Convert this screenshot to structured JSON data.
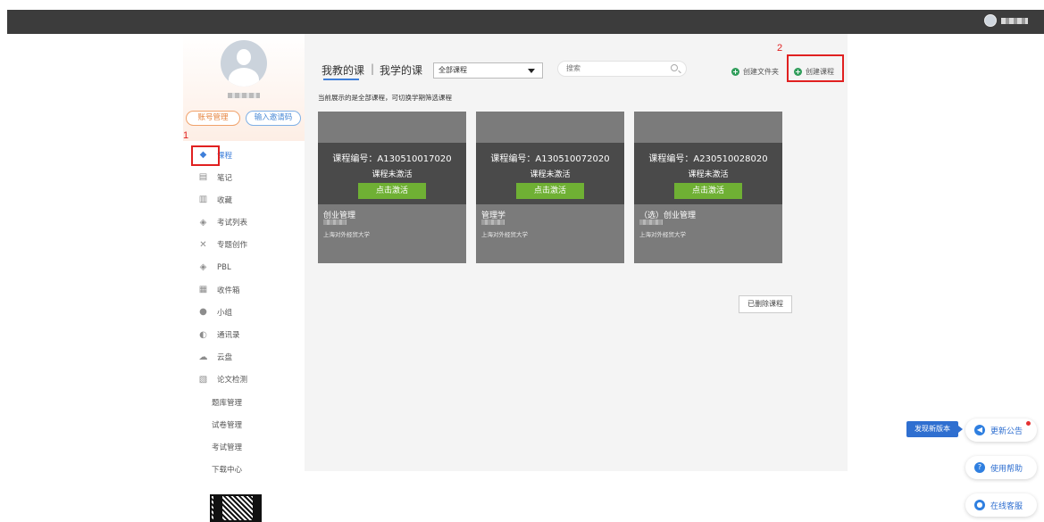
{
  "sidebar": {
    "account_btn": "账号管理",
    "invite_btn": "输入邀请码",
    "items": [
      {
        "label": "课程",
        "icon": "course-icon",
        "active": true
      },
      {
        "label": "笔记",
        "icon": "note-icon"
      },
      {
        "label": "收藏",
        "icon": "favorite-icon"
      },
      {
        "label": "考试列表",
        "icon": "exam-list-icon"
      },
      {
        "label": "专题创作",
        "icon": "topic-icon"
      },
      {
        "label": "PBL",
        "icon": "pbl-icon"
      },
      {
        "label": "收件箱",
        "icon": "inbox-icon"
      },
      {
        "label": "小组",
        "icon": "group-icon"
      },
      {
        "label": "通讯录",
        "icon": "contacts-icon"
      },
      {
        "label": "云盘",
        "icon": "cloud-icon"
      },
      {
        "label": "论文检测",
        "icon": "paper-check-icon"
      },
      {
        "label": "题库管理",
        "sub": true
      },
      {
        "label": "试卷管理",
        "sub": true
      },
      {
        "label": "考试管理",
        "sub": true
      },
      {
        "label": "下载中心",
        "sub": true
      }
    ]
  },
  "annotations": {
    "step1": "1",
    "step2": "2"
  },
  "header": {
    "tab_teach": "我教的课",
    "tab_sep": "|",
    "tab_learn": "我学的课",
    "select_value": "全部课程",
    "search_placeholder": "搜索",
    "create_folder": "创建文件夹",
    "create_course": "创建课程"
  },
  "notice": "当前展示的是全部课程，可切换学期筛选课程",
  "courses": [
    {
      "code": "课程编号：A130510017020",
      "status": "课程未激活",
      "activate": "点击激活",
      "name": "创业管理",
      "school": "上海对外经贸大学"
    },
    {
      "code": "课程编号：A130510072020",
      "status": "课程未激活",
      "activate": "点击激活",
      "name": "管理学",
      "school": "上海对外经贸大学"
    },
    {
      "code": "课程编号：A230510028020",
      "status": "课程未激活",
      "activate": "点击激活",
      "name": "（选）创业管理",
      "school": "上海对外经贸大学"
    }
  ],
  "deleted_courses": "已删除课程",
  "floating": {
    "new_version": "发现新版本",
    "update_notice": "更新公告",
    "help": "使用帮助",
    "service": "在线客服"
  }
}
